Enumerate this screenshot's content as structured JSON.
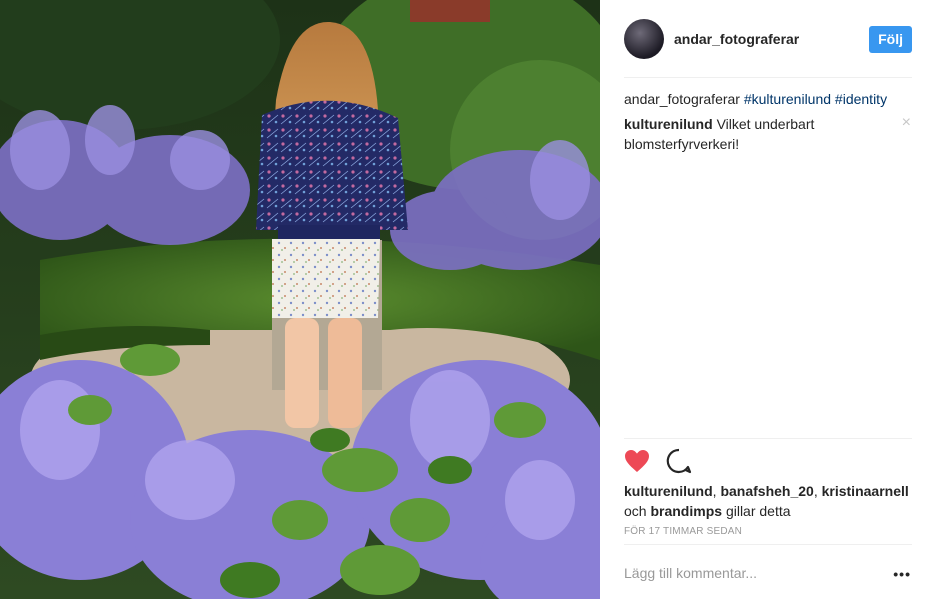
{
  "post": {
    "author": "andar_fotograferar",
    "follow_label": "Följ",
    "caption": {
      "username": "andar_fotograferar",
      "hashtags": [
        "#kulturenilund",
        "#identity"
      ]
    },
    "comment": {
      "username": "kulturenilund",
      "text": "Vilket underbart blomsterfyrverkeri!"
    },
    "likes": {
      "users": [
        "kulturenilund",
        "banafsheh_20",
        "kristinaarnell",
        "brandimps"
      ],
      "separator": ", ",
      "och": "och",
      "suffix": "gillar detta"
    },
    "time": "FÖR 17 TIMMAR SEDAN",
    "add_comment_placeholder": "Lägg till kommentar...",
    "more_label": "•••",
    "close_label": "×"
  },
  "icons": {
    "like": "heart-icon",
    "comment": "comment-icon",
    "close": "close-icon",
    "more": "more-options-icon"
  },
  "colors": {
    "like_red": "#ed4956",
    "follow_blue": "#3897f0",
    "hashtag": "#003569",
    "muted": "#999999"
  }
}
